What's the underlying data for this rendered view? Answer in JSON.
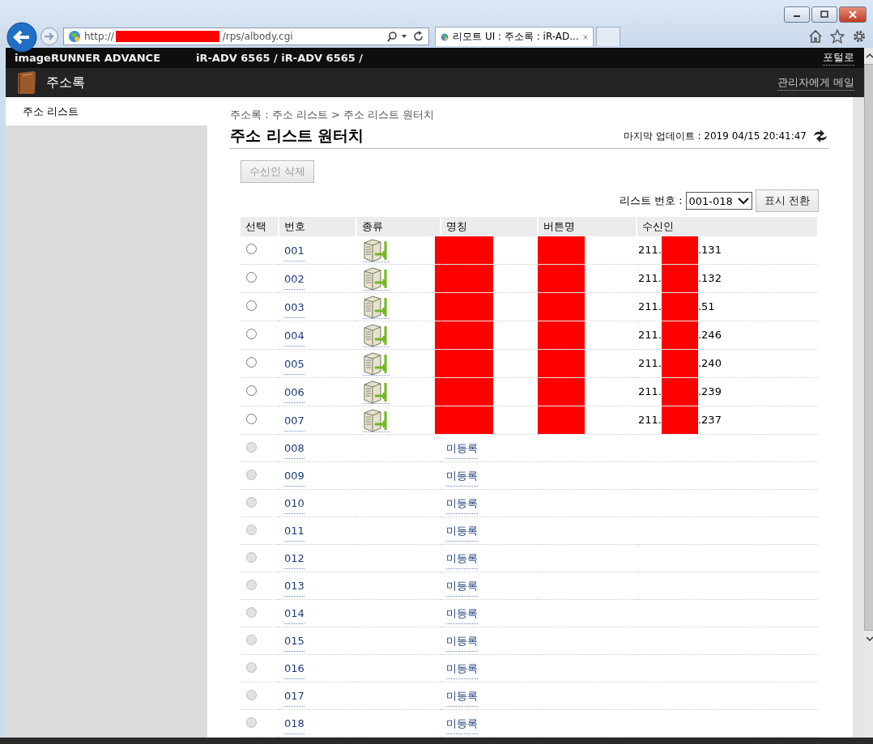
{
  "browser": {
    "url_start": "http://",
    "url_end": "/rps/albody.cgi",
    "tab_title": "리모트 UI : 주소록 : iR-AD..."
  },
  "header": {
    "product": "imageRUNNER ADVANCE",
    "device": "iR-ADV 6565 / iR-ADV 6565 /",
    "portal_link": "포털로",
    "section": "주소록",
    "admin_mail_link": "관리자에게 메일"
  },
  "sidebar": {
    "items": [
      {
        "label": "주소 리스트",
        "selected": true
      }
    ]
  },
  "breadcrumb": "주소록 : 주소 리스트 > 주소 리스트 원터치",
  "page_title": "주소 리스트 원터치",
  "last_update": "마지막 업데이트 : 2019 04/15 20:41:47",
  "delete_button": {
    "label": "수신인 삭제",
    "disabled": true
  },
  "list_number": {
    "label": "리스트 번호 :",
    "value": "001-018"
  },
  "switch_button": "표시 전환",
  "table": {
    "columns": [
      "선택",
      "번호",
      "종류",
      "명칭",
      "버튼명",
      "수신인"
    ],
    "rows": [
      {
        "number": "001",
        "kind": "registered",
        "selected": false,
        "disabled": false,
        "recipient_start": "211.",
        "recipient_end": ".131"
      },
      {
        "number": "002",
        "kind": "registered",
        "selected": false,
        "disabled": false,
        "recipient_start": "211.",
        "recipient_end": ".132"
      },
      {
        "number": "003",
        "kind": "registered",
        "selected": false,
        "disabled": false,
        "recipient_start": "211.",
        "recipient_end": ".51"
      },
      {
        "number": "004",
        "kind": "registered",
        "selected": false,
        "disabled": false,
        "recipient_start": "211.",
        "recipient_end": ".246"
      },
      {
        "number": "005",
        "kind": "registered",
        "selected": false,
        "disabled": false,
        "recipient_start": "211.",
        "recipient_end": ".240"
      },
      {
        "number": "006",
        "kind": "registered",
        "selected": false,
        "disabled": false,
        "recipient_start": "211.",
        "recipient_end": ".239"
      },
      {
        "number": "007",
        "kind": "registered",
        "selected": false,
        "disabled": false,
        "recipient_start": "211.",
        "recipient_end": ".237"
      },
      {
        "number": "008",
        "kind": "unregistered",
        "selected": false,
        "disabled": true,
        "name": "미등록"
      },
      {
        "number": "009",
        "kind": "unregistered",
        "selected": false,
        "disabled": true,
        "name": "미등록"
      },
      {
        "number": "010",
        "kind": "unregistered",
        "selected": false,
        "disabled": true,
        "name": "미등록"
      },
      {
        "number": "011",
        "kind": "unregistered",
        "selected": false,
        "disabled": true,
        "name": "미등록"
      },
      {
        "number": "012",
        "kind": "unregistered",
        "selected": false,
        "disabled": true,
        "name": "미등록"
      },
      {
        "number": "013",
        "kind": "unregistered",
        "selected": false,
        "disabled": true,
        "name": "미등록"
      },
      {
        "number": "014",
        "kind": "unregistered",
        "selected": false,
        "disabled": true,
        "name": "미등록"
      },
      {
        "number": "015",
        "kind": "unregistered",
        "selected": false,
        "disabled": true,
        "name": "미등록"
      },
      {
        "number": "016",
        "kind": "unregistered",
        "selected": false,
        "disabled": true,
        "name": "미등록"
      },
      {
        "number": "017",
        "kind": "unregistered",
        "selected": false,
        "disabled": true,
        "name": "미등록"
      },
      {
        "number": "018",
        "kind": "unregistered",
        "selected": false,
        "disabled": true,
        "name": "미등록"
      }
    ]
  }
}
